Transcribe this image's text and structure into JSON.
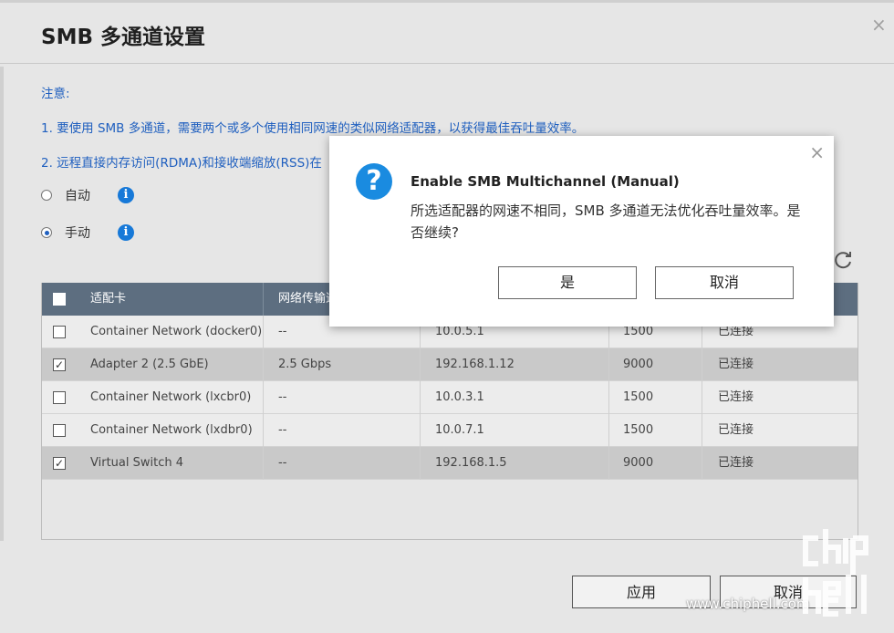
{
  "window": {
    "title": "SMB 多通道设置",
    "close_glyph": "×"
  },
  "notes": {
    "heading": "注意:",
    "line1": "1. 要使用 SMB 多通道，需要两个或多个使用相同网速的类似网络适配器，以获得最佳吞吐量效率。",
    "line2": "2. 远程直接内存访问(RDMA)和接收端缩放(RSS)在"
  },
  "mode": {
    "auto_label": "自动",
    "manual_label": "手动",
    "selected": "manual",
    "info_glyph": "i"
  },
  "table": {
    "columns": [
      "适配卡",
      "网络传输速"
    ],
    "rows": [
      {
        "checked": false,
        "adapter": "Container Network (docker0)",
        "speed": "--",
        "ip": "10.0.5.1",
        "mtu": "1500",
        "status": "已连接"
      },
      {
        "checked": true,
        "adapter": "Adapter 2 (2.5 GbE)",
        "speed": "2.5 Gbps",
        "ip": "192.168.1.12",
        "mtu": "9000",
        "status": "已连接"
      },
      {
        "checked": false,
        "adapter": "Container Network (lxcbr0)",
        "speed": "--",
        "ip": "10.0.3.1",
        "mtu": "1500",
        "status": "已连接"
      },
      {
        "checked": false,
        "adapter": "Container Network (lxdbr0)",
        "speed": "--",
        "ip": "10.0.7.1",
        "mtu": "1500",
        "status": "已连接"
      },
      {
        "checked": true,
        "adapter": "Virtual Switch 4",
        "speed": "--",
        "ip": "192.168.1.5",
        "mtu": "9000",
        "status": "已连接"
      }
    ]
  },
  "footer": {
    "apply_label": "应用",
    "cancel_label": "取消"
  },
  "watermark": {
    "url": "www.chiphell.com"
  },
  "dialog": {
    "title": "Enable SMB Multichannel (Manual)",
    "message": "所选适配器的网速不相同，SMB 多通道无法优化吞吐量效率。是否继续?",
    "yes_label": "是",
    "cancel_label": "取消",
    "close_glyph": "×",
    "icon_glyph": "?"
  },
  "colors": {
    "note_blue": "#1f5fbf",
    "header_bg": "#5d6e80",
    "question_icon": "#1a8be0"
  },
  "icons": [
    "close-icon",
    "info-icon",
    "refresh-icon",
    "checkbox-icon",
    "question-icon"
  ]
}
